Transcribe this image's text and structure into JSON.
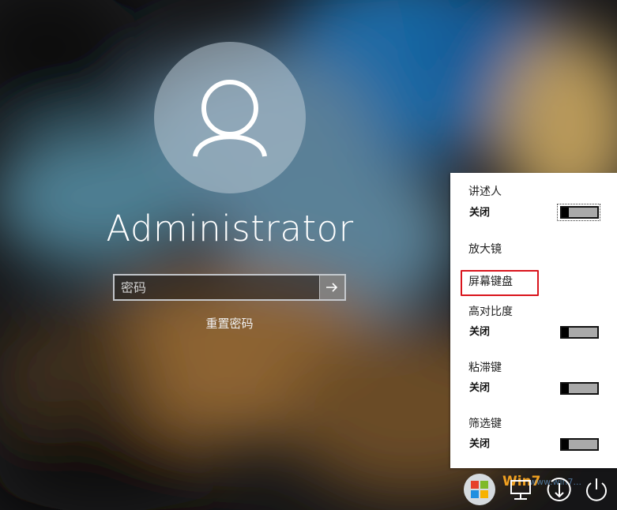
{
  "user": {
    "name": "Administrator"
  },
  "login": {
    "password_placeholder": "密码",
    "reset_password": "重置密码"
  },
  "ease_of_access_menu": {
    "items": [
      {
        "label": "讲述人",
        "state": "关闭",
        "has_toggle": true,
        "toggle_on": false,
        "focused": true
      },
      {
        "label": "放大镜"
      },
      {
        "label": "屏幕键盘",
        "highlighted": true
      },
      {
        "label": "高对比度",
        "state": "关闭",
        "has_toggle": true,
        "toggle_on": false
      },
      {
        "label": "粘滞键",
        "state": "关闭",
        "has_toggle": true,
        "toggle_on": false
      },
      {
        "label": "筛选键",
        "state": "关闭",
        "has_toggle": true,
        "toggle_on": false
      }
    ],
    "highlight_color": "#d9141c"
  },
  "bottom_icons": [
    {
      "name": "network-icon"
    },
    {
      "name": "ease-of-access-icon"
    },
    {
      "name": "power-icon"
    }
  ],
  "watermark": {
    "logo_text": "Win7",
    "url_text": "www.win7..."
  },
  "colors": {
    "menu_background": "#ffffff",
    "toggle_off_track": "#a9a9a9",
    "text_light": "#ffffff"
  }
}
